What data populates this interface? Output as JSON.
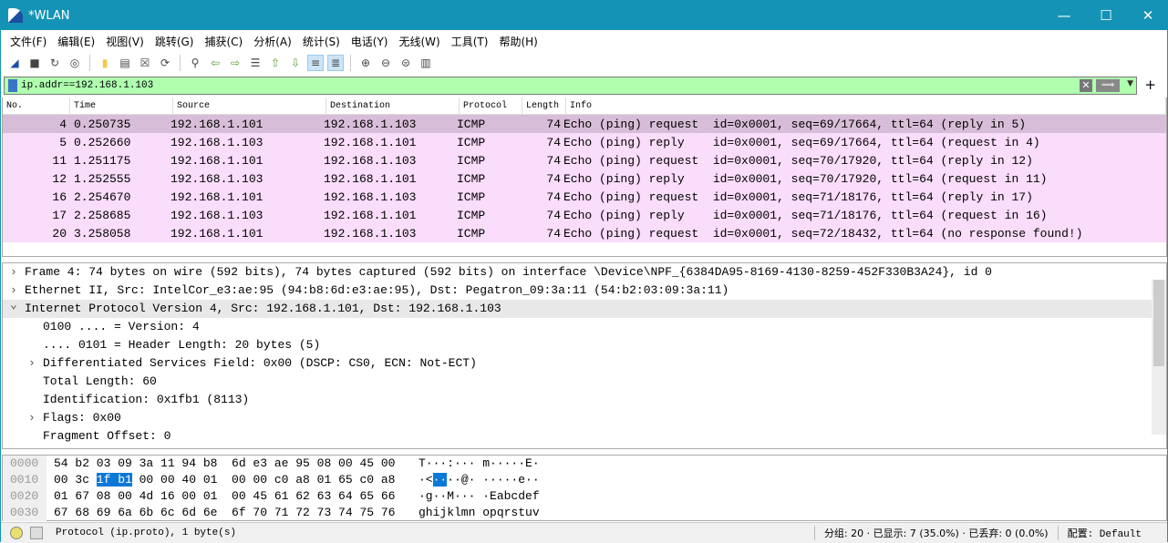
{
  "window": {
    "title": "*WLAN",
    "minimize": "—",
    "maximize": "☐",
    "close": "✕"
  },
  "menu": [
    "文件(F)",
    "编辑(E)",
    "视图(V)",
    "跳转(G)",
    "捕获(C)",
    "分析(A)",
    "统计(S)",
    "电话(Y)",
    "无线(W)",
    "工具(T)",
    "帮助(H)"
  ],
  "toolbar": [
    "start-capture-icon",
    "stop-capture-icon",
    "restart-capture-icon",
    "capture-options-icon",
    "open-file-icon",
    "save-file-icon",
    "close-file-icon",
    "reload-icon",
    "find-packet-icon",
    "go-back-icon",
    "go-forward-icon",
    "go-to-packet-icon",
    "first-packet-icon",
    "last-packet-icon",
    "autoscroll-icon",
    "colorize-icon",
    "zoom-in-icon",
    "zoom-out-icon",
    "zoom-normal-icon",
    "resize-columns-icon"
  ],
  "filter": {
    "value": "ip.addr==192.168.1.103",
    "color": "#afffaf"
  },
  "packet_list": {
    "columns": [
      "No.",
      "Time",
      "Source",
      "Destination",
      "Protocol",
      "Length",
      "Info"
    ],
    "rows": [
      [
        "4",
        "0.250735",
        "192.168.1.101",
        "192.168.1.103",
        "ICMP",
        "74",
        "Echo (ping) request  id=0x0001, seq=69/17664, ttl=64 (reply in 5)"
      ],
      [
        "5",
        "0.252660",
        "192.168.1.103",
        "192.168.1.101",
        "ICMP",
        "74",
        "Echo (ping) reply    id=0x0001, seq=69/17664, ttl=64 (request in 4)"
      ],
      [
        "11",
        "1.251175",
        "192.168.1.101",
        "192.168.1.103",
        "ICMP",
        "74",
        "Echo (ping) request  id=0x0001, seq=70/17920, ttl=64 (reply in 12)"
      ],
      [
        "12",
        "1.252555",
        "192.168.1.103",
        "192.168.1.101",
        "ICMP",
        "74",
        "Echo (ping) reply    id=0x0001, seq=70/17920, ttl=64 (request in 11)"
      ],
      [
        "16",
        "2.254670",
        "192.168.1.101",
        "192.168.1.103",
        "ICMP",
        "74",
        "Echo (ping) request  id=0x0001, seq=71/18176, ttl=64 (reply in 17)"
      ],
      [
        "17",
        "2.258685",
        "192.168.1.103",
        "192.168.1.101",
        "ICMP",
        "74",
        "Echo (ping) reply    id=0x0001, seq=71/18176, ttl=64 (request in 16)"
      ],
      [
        "20",
        "3.258058",
        "192.168.1.101",
        "192.168.1.103",
        "ICMP",
        "74",
        "Echo (ping) request  id=0x0001, seq=72/18432, ttl=64 (no response found!)"
      ]
    ],
    "selected_row": 0,
    "row_color": "#fadcfb",
    "selected_color": "#d8bdd8"
  },
  "details": [
    {
      "text": "Frame 4: 74 bytes on wire (592 bits), 74 bytes captured (592 bits) on interface \\Device\\NPF_{6384DA95-8169-4130-8259-452F330B3A24}, id 0",
      "level": 0,
      "expander": "collapsed"
    },
    {
      "text": "Ethernet II, Src: IntelCor_e3:ae:95 (94:b8:6d:e3:ae:95), Dst: Pegatron_09:3a:11 (54:b2:03:09:3a:11)",
      "level": 0,
      "expander": "collapsed"
    },
    {
      "text": "Internet Protocol Version 4, Src: 192.168.1.101, Dst: 192.168.1.103",
      "level": 0,
      "expander": "expanded"
    },
    {
      "text": "0100 .... = Version: 4",
      "level": 1,
      "expander": "none"
    },
    {
      "text": ".... 0101 = Header Length: 20 bytes (5)",
      "level": 1,
      "expander": "none"
    },
    {
      "text": "Differentiated Services Field: 0x00 (DSCP: CS0, ECN: Not-ECT)",
      "level": 1,
      "expander": "collapsed"
    },
    {
      "text": "Total Length: 60",
      "level": 1,
      "expander": "none"
    },
    {
      "text": "Identification: 0x1fb1 (8113)",
      "level": 1,
      "expander": "none"
    },
    {
      "text": "Flags: 0x00",
      "level": 1,
      "expander": "collapsed"
    },
    {
      "text": "Fragment Offset: 0",
      "level": 1,
      "expander": "none"
    }
  ],
  "hex": [
    {
      "offset": "0000",
      "bytes": [
        "54 b2 03 09 3a 11 94 b8  6d e3 ae 95 08 00 45 00"
      ],
      "ascii": "T···:··· m·····E·"
    },
    {
      "offset": "0010",
      "pre": "00 3c ",
      "sel": "1f b1",
      "post": " 00 00 40 01  00 00 c0 a8 01 65 c0 a8",
      "apre": "·<",
      "asel": "··",
      "apost": "··@· ·····e··"
    },
    {
      "offset": "0020",
      "bytes": [
        "01 67 08 00 4d 16 00 01  00 45 61 62 63 64 65 66"
      ],
      "ascii": "·g··M··· ·Eabcdef"
    },
    {
      "offset": "0030",
      "bytes": [
        "67 68 69 6a 6b 6c 6d 6e  6f 70 71 72 73 74 75 76"
      ],
      "ascii": "ghijklmn opqrstuv"
    }
  ],
  "status": {
    "field": "Protocol (ip.proto), 1 byte(s)",
    "packets": "分组: 20 · 已显示: 7 (35.0%) · 已丢弃: 0 (0.0%)",
    "profile": "配置: Default"
  }
}
